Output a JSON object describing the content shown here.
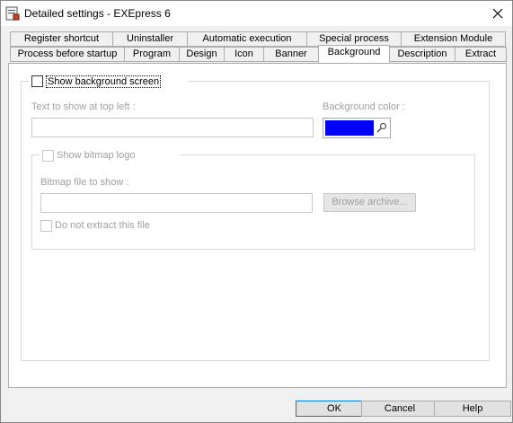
{
  "window": {
    "title": "Detailed settings - EXEpress 6"
  },
  "tabs": {
    "row_back": [
      "Register shortcut",
      "Uninstaller",
      "Automatic execution",
      "Special process",
      "Extension Module"
    ],
    "row_front": [
      "Process before startup",
      "Program",
      "Design",
      "Icon",
      "Banner",
      "Background",
      "Description",
      "Extract"
    ],
    "active": "Background"
  },
  "background_tab": {
    "show_background_label": "Show background screen",
    "show_background_checked": false,
    "text_top_left_label": "Text to show at top left :",
    "text_top_left_value": "",
    "background_color_label": "Background color :",
    "background_color": "#0000ff",
    "show_bitmap_logo_label": "Show bitmap logo",
    "bitmap_file_label": "Bitmap file to show :",
    "bitmap_file_value": "",
    "browse_label": "Browse archive...",
    "do_not_extract_label": "Do not extract this file"
  },
  "buttons": {
    "ok": "OK",
    "cancel": "Cancel",
    "help": "Help"
  }
}
